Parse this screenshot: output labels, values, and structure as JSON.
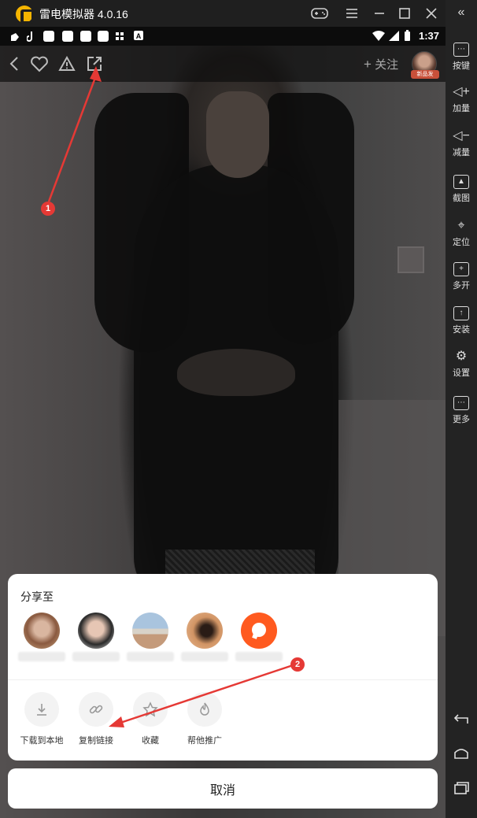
{
  "window": {
    "title": "雷电模拟器 4.0.16",
    "controls": [
      "gamepad-icon",
      "menu-icon",
      "minimize-icon",
      "maximize-icon",
      "close-icon"
    ]
  },
  "statusbar": {
    "time": "1:37",
    "icons": [
      "tiktok-icon",
      "tiktok-icon",
      "app-icon",
      "app-icon",
      "app-icon",
      "app-icon",
      "bug-icon",
      "a-icon",
      "wifi-icon",
      "signal-icon",
      "battery-icon"
    ]
  },
  "topbar": {
    "follow_label": "关注",
    "avatar_badge": "新品发",
    "icons": [
      "back-icon",
      "heart-icon",
      "report-icon",
      "share-icon"
    ]
  },
  "share_sheet": {
    "title": "分享至",
    "contacts": [
      "avatar-1",
      "avatar-2",
      "avatar-3",
      "avatar-4",
      "more-contacts"
    ],
    "actions": [
      {
        "label": "下载到本地",
        "icon": "download-icon"
      },
      {
        "label": "复制链接",
        "icon": "link-icon"
      },
      {
        "label": "收藏",
        "icon": "star-icon"
      },
      {
        "label": "帮他推广",
        "icon": "fire-icon"
      }
    ],
    "cancel_label": "取消"
  },
  "annotations": [
    {
      "number": "1",
      "target": "share-icon"
    },
    {
      "number": "2",
      "target": "copy-link"
    }
  ],
  "sidebar": {
    "items": [
      {
        "label": "按键",
        "icon": "keyboard-icon"
      },
      {
        "label": "加量",
        "icon": "volume-up-icon"
      },
      {
        "label": "减量",
        "icon": "volume-down-icon"
      },
      {
        "label": "截图",
        "icon": "screenshot-icon"
      },
      {
        "label": "定位",
        "icon": "location-icon"
      },
      {
        "label": "多开",
        "icon": "multi-instance-icon"
      },
      {
        "label": "安装",
        "icon": "install-icon"
      },
      {
        "label": "设置",
        "icon": "settings-icon"
      },
      {
        "label": "更多",
        "icon": "more-icon"
      }
    ],
    "nav": [
      "back-nav-icon",
      "home-nav-icon",
      "recents-nav-icon"
    ]
  },
  "colors": {
    "accent_orange": "#ff5a1f",
    "annotation_red": "#e53935",
    "emulator_bg": "#1f1f1f"
  }
}
